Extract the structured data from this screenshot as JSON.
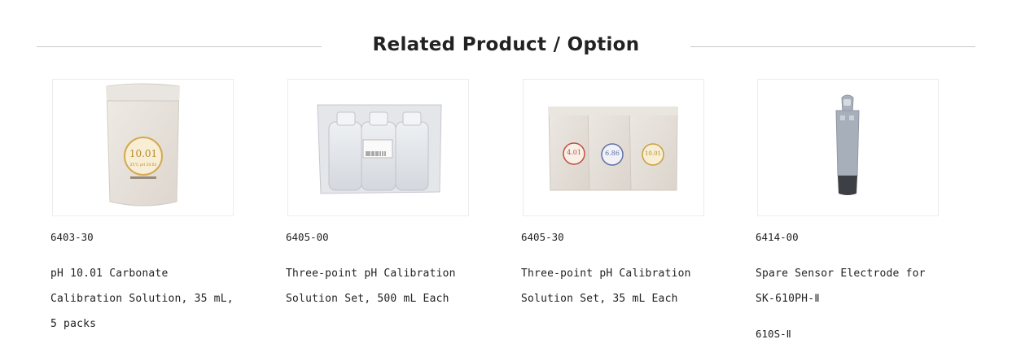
{
  "section": {
    "heading": "Related Product / Option"
  },
  "products": [
    {
      "code": "6403-30",
      "name": "pH 10.01 Carbonate Calibration Solution, 35 mL, 5 packs",
      "image_icon": "calibration-pouch-icon"
    },
    {
      "code": "6405-00",
      "name": "Three-point pH Calibration Solution Set, 500 mL Each",
      "image_icon": "bottle-set-icon"
    },
    {
      "code": "6405-30",
      "name": "Three-point pH Calibration Solution Set, 35 mL Each",
      "image_icon": "pouch-set-icon"
    },
    {
      "code": "6414-00",
      "name": "Spare Sensor Electrode for SK-610PH-Ⅱ",
      "note": "610S-Ⅱ",
      "image_icon": "electrode-icon"
    }
  ],
  "pouch_labels": {
    "single": {
      "value": "10.01",
      "small": "25℃ pH 10.01"
    },
    "set": [
      "4.01",
      "6.86",
      "10.01"
    ]
  },
  "colors": {
    "rule": "#c8c8c8",
    "pouch": "#e7e2dc",
    "label_red": "#c05040",
    "label_blue": "#6070a8",
    "label_gold": "#c8a040"
  }
}
